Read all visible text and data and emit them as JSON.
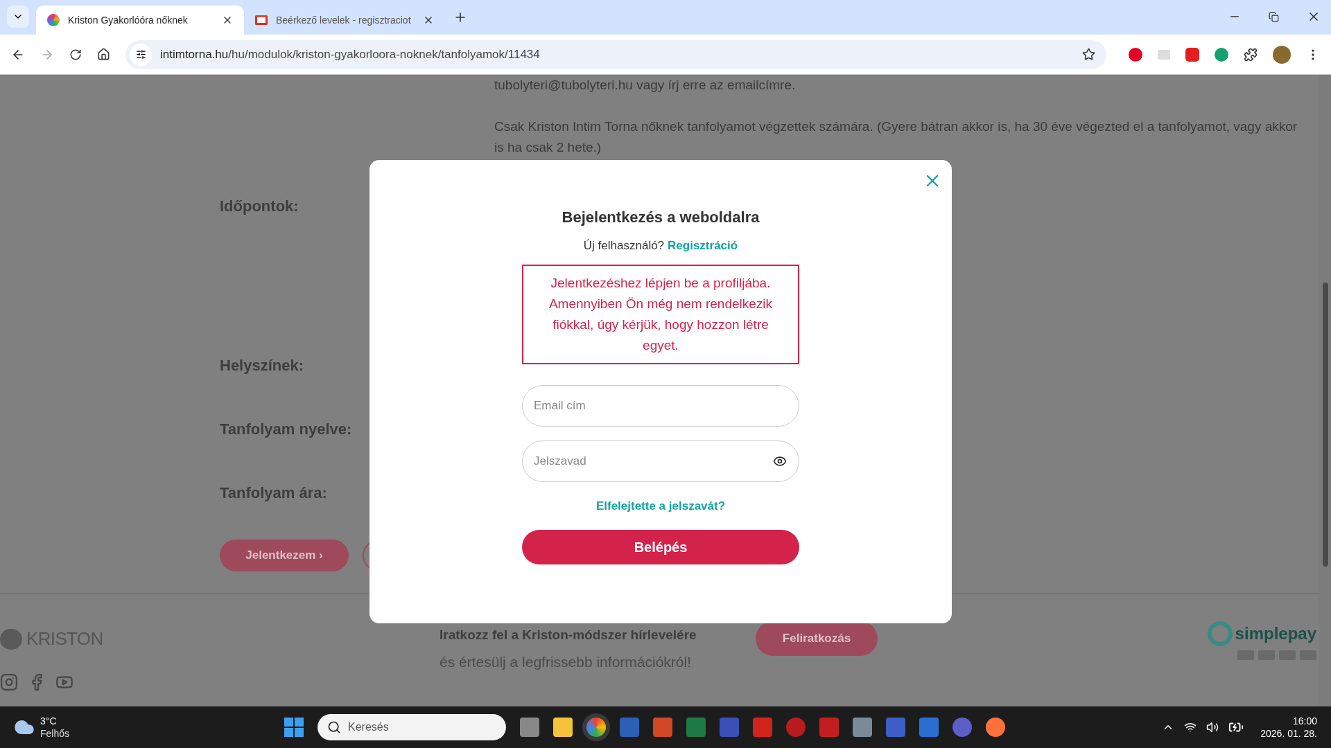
{
  "browser": {
    "tabs": [
      {
        "title": "Kriston Gyakorlóóra nőknek",
        "selected": true
      },
      {
        "title": "Beérkező levelek - regisztraciot",
        "selected": false
      }
    ],
    "url_host": "intimtorna.hu",
    "url_path": "/hu/modulok/kriston-gyakorloora-noknek/tanfolyamok/11434"
  },
  "page": {
    "intro": [
      "tubolyteri@tubolyteri.hu vagy írj erre az emailcímre.",
      "Csak Kriston Intim Torna nőknek tanfolyamot végzettek számára. (Gyere bátran akkor is, ha 30 éve végezted el a tanfolyamot, vagy akkor is ha csak 2 hete.)"
    ],
    "labels": [
      "Időpontok:",
      "Helyszínek:",
      "Tanfolyam nyelve:",
      "Tanfolyam ára:"
    ],
    "apply_button": "Jelentkezem ›"
  },
  "footer": {
    "logo": "KRISTON",
    "newsletter_title": "Iratkozz fel a Kriston-módszer hírlevelére",
    "newsletter_text": "és értesülj a legfrissebb információkról!",
    "subscribe_button": "Feliratkozás",
    "payment_logo": "simplepay"
  },
  "modal": {
    "title": "Bejelentkezés a weboldalra",
    "prompt": "Új felhasználó?",
    "register_link": "Regisztráció",
    "alert": "Jelentkezéshez lépjen be a profiljába. Amennyiben Ön még nem rendelkezik fiókkal, úgy kérjük, hogy hozzon létre egyet.",
    "email_placeholder": "Email cím",
    "password_placeholder": "Jelszavad",
    "forgot_link": "Elfelejtette a jelszavát?",
    "submit": "Belépés"
  },
  "taskbar": {
    "temperature": "3°C",
    "weather": "Felhős",
    "search_placeholder": "Keresés",
    "time": "16:00",
    "date": "2026. 01. 28."
  }
}
